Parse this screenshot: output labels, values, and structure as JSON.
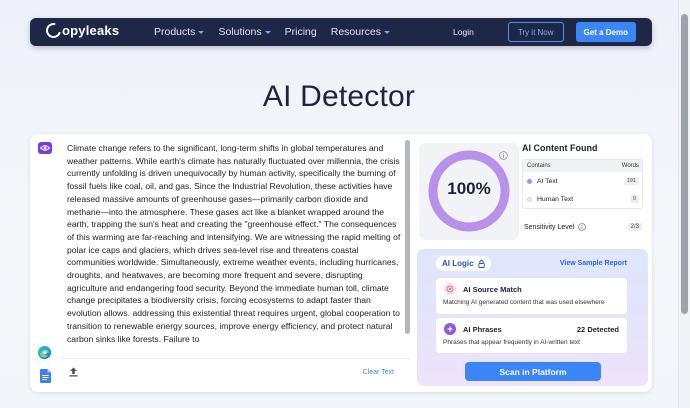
{
  "nav": {
    "brand": "opyleaks",
    "items": [
      {
        "label": "Products",
        "has_menu": true
      },
      {
        "label": "Solutions",
        "has_menu": true
      },
      {
        "label": "Pricing",
        "has_menu": false
      },
      {
        "label": "Resources",
        "has_menu": true
      }
    ],
    "login_label": "Login",
    "try_label": "Try it Now",
    "demo_label": "Get a Demo"
  },
  "page": {
    "title": "AI Detector"
  },
  "editor": {
    "text": "Climate change refers to the significant, long-term shifts in global temperatures and weather patterns. While earth's climate has naturally fluctuated over millennia, the crisis currently unfolding is driven unequivocally by human activity, specifically the burning of fossil fuels like coal, oil, and gas. Since the Industrial Revolution, these activities have released massive amounts of greenhouse gases—primarily carbon dioxide and methane—into the atmosphere. These gases act like a blanket wrapped around the earth, trapping the sun's heat and creating the \"greenhouse effect.\" The consequences of this warming are far-reaching and intensifying. We are witnessing the rapid melting of polar ice caps and glaciers, which drives sea-level rise and threatens coastal communities worldwide. Simultaneously, extreme weather events, including hurricanes, droughts, and heatwaves, are becoming more frequent and severe, disrupting agriculture and endangering food security. Beyond the immediate human toll, climate change precipitates a biodiversity crisis, forcing ecosystems to adapt faster than evolution allows. addressing this existential threat requires urgent, global cooperation to transition to renewable energy sources, improve energy efficiency, and protect natural carbon sinks like forests. Failure to",
    "clear_label": "Clear Text"
  },
  "result": {
    "score_label": "100%",
    "score_fraction": 1.0,
    "found_title": "AI Content Found",
    "table_headers": {
      "contains": "Contains",
      "words": "Words"
    },
    "rows": [
      {
        "label": "AI Text",
        "count": "191",
        "dot_color": "#b48ae8"
      },
      {
        "label": "Human Text",
        "count": "0",
        "dot_color": "#e7e9ee"
      }
    ],
    "sensitivity_label": "Sensitivity Level",
    "sensitivity_value": "2/3"
  },
  "logic": {
    "title": "AI Logic",
    "sample_link": "View Sample Report",
    "source_match": {
      "title": "AI Source Match",
      "desc": "Matching AI generated content that was used elsewhere"
    },
    "phrases": {
      "title": "AI Phrases",
      "count": "22 Detected",
      "desc": "Phrases that appear frequently in AI-written text"
    },
    "scan_label": "Scan in Platform"
  },
  "colors": {
    "nav_bg": "#1f2746",
    "accent_blue": "#3b86f7",
    "ai_purple": "#b48ae8",
    "ring_purple": "#b891ea"
  }
}
